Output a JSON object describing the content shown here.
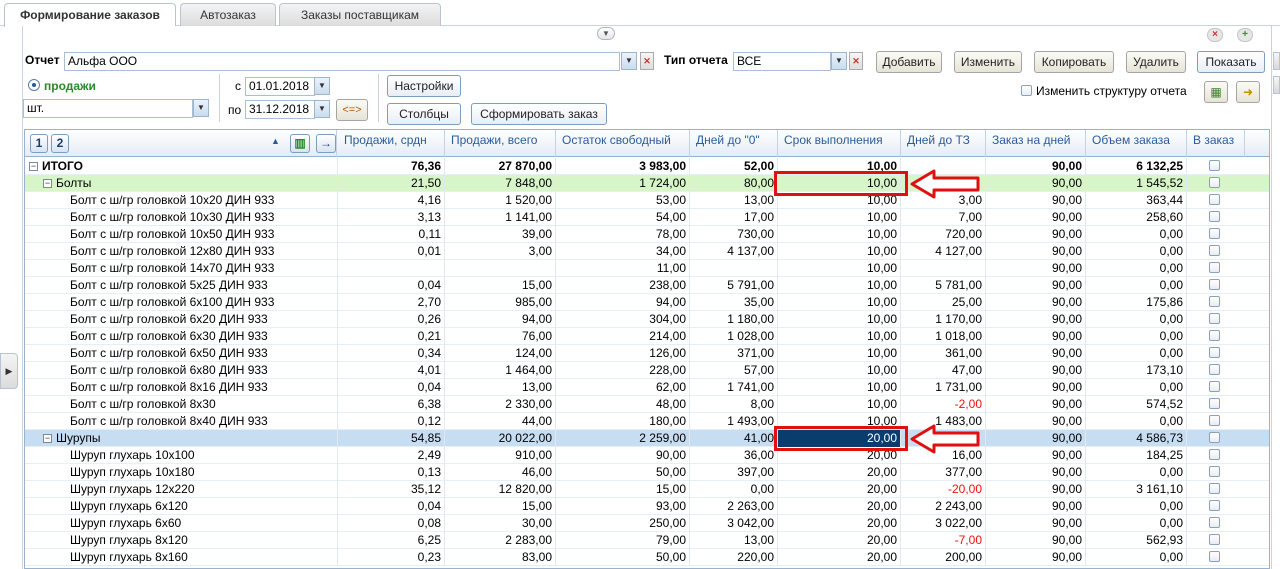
{
  "tabs": [
    "Формирование заказов",
    "Автозаказ",
    "Заказы поставщикам"
  ],
  "filters": {
    "report_label": "Отчет",
    "report_value": "Альфа ООО",
    "report_type_label": "Тип отчета",
    "report_type_value": "ВСЕ",
    "mode_label": "продажи",
    "unit_value": "шт.",
    "from_label": "с",
    "from_value": "01.01.2018",
    "to_label": "по",
    "to_value": "31.12.2018",
    "swap_label": "<=>"
  },
  "buttons": {
    "add": "Добавить",
    "edit": "Изменить",
    "copy": "Копировать",
    "delete": "Удалить",
    "show": "Показать",
    "settings": "Настройки",
    "columns": "Столбцы",
    "make_order": "Сформировать заказ"
  },
  "change_structure_label": "Изменить структуру отчета",
  "grid": {
    "pages": [
      "1",
      "2"
    ],
    "columns": [
      "Продажи, срдн",
      "Продажи, всего",
      "Остаток свободный",
      "Дней до \"0\"",
      "Срок выполнения",
      "Дней до ТЗ",
      "Заказ на дней",
      "Объем заказа",
      "В заказ"
    ],
    "rows": [
      {
        "name": "ИТОГО",
        "level": 0,
        "vals": [
          "76,36",
          "27 870,00",
          "3 983,00",
          "52,00",
          "10,00",
          "",
          "90,00",
          "6 132,25"
        ]
      },
      {
        "name": "Болты",
        "level": 1,
        "vals": [
          "21,50",
          "7 848,00",
          "1 724,00",
          "80,00",
          "10,00",
          "",
          "90,00",
          "1 545,52"
        ]
      },
      {
        "name": "Болт с ш/гр головкой 10х20 ДИН 933",
        "level": 2,
        "vals": [
          "4,16",
          "1 520,00",
          "53,00",
          "13,00",
          "10,00",
          "3,00",
          "90,00",
          "363,44"
        ]
      },
      {
        "name": "Болт с ш/гр головкой 10х30 ДИН 933",
        "level": 2,
        "vals": [
          "3,13",
          "1 141,00",
          "54,00",
          "17,00",
          "10,00",
          "7,00",
          "90,00",
          "258,60"
        ]
      },
      {
        "name": "Болт с ш/гр головкой 10х50 ДИН 933",
        "level": 2,
        "vals": [
          "0,11",
          "39,00",
          "78,00",
          "730,00",
          "10,00",
          "720,00",
          "90,00",
          "0,00"
        ]
      },
      {
        "name": "Болт с ш/гр головкой 12х80 ДИН 933",
        "level": 2,
        "vals": [
          "0,01",
          "3,00",
          "34,00",
          "4 137,00",
          "10,00",
          "4 127,00",
          "90,00",
          "0,00"
        ]
      },
      {
        "name": "Болт с ш/гр головкой 14х70 ДИН 933",
        "level": 2,
        "vals": [
          "",
          "",
          "11,00",
          "",
          "10,00",
          "",
          "90,00",
          "0,00"
        ]
      },
      {
        "name": "Болт с ш/гр головкой 5х25 ДИН 933",
        "level": 2,
        "vals": [
          "0,04",
          "15,00",
          "238,00",
          "5 791,00",
          "10,00",
          "5 781,00",
          "90,00",
          "0,00"
        ]
      },
      {
        "name": "Болт с ш/гр головкой 6х100 ДИН 933",
        "level": 2,
        "vals": [
          "2,70",
          "985,00",
          "94,00",
          "35,00",
          "10,00",
          "25,00",
          "90,00",
          "175,86"
        ]
      },
      {
        "name": "Болт с ш/гр головкой 6х20 ДИН 933",
        "level": 2,
        "vals": [
          "0,26",
          "94,00",
          "304,00",
          "1 180,00",
          "10,00",
          "1 170,00",
          "90,00",
          "0,00"
        ]
      },
      {
        "name": "Болт с ш/гр головкой 6х30 ДИН 933",
        "level": 2,
        "vals": [
          "0,21",
          "76,00",
          "214,00",
          "1 028,00",
          "10,00",
          "1 018,00",
          "90,00",
          "0,00"
        ]
      },
      {
        "name": "Болт с ш/гр головкой 6х50 ДИН 933",
        "level": 2,
        "vals": [
          "0,34",
          "124,00",
          "126,00",
          "371,00",
          "10,00",
          "361,00",
          "90,00",
          "0,00"
        ]
      },
      {
        "name": "Болт с ш/гр головкой 6х80 ДИН 933",
        "level": 2,
        "vals": [
          "4,01",
          "1 464,00",
          "228,00",
          "57,00",
          "10,00",
          "47,00",
          "90,00",
          "173,10"
        ]
      },
      {
        "name": "Болт с ш/гр головкой 8х16 ДИН 933",
        "level": 2,
        "vals": [
          "0,04",
          "13,00",
          "62,00",
          "1 741,00",
          "10,00",
          "1 731,00",
          "90,00",
          "0,00"
        ]
      },
      {
        "name": "Болт с ш/гр головкой 8х30",
        "level": 2,
        "vals": [
          "6,38",
          "2 330,00",
          "48,00",
          "8,00",
          "10,00",
          "-2,00",
          "90,00",
          "574,52"
        ]
      },
      {
        "name": "Болт с ш/гр головкой 8х40 ДИН 933",
        "level": 2,
        "vals": [
          "0,12",
          "44,00",
          "180,00",
          "1 493,00",
          "10,00",
          "1 483,00",
          "90,00",
          "0,00"
        ]
      },
      {
        "name": "Шурупы",
        "level": 1,
        "vals": [
          "54,85",
          "20 022,00",
          "2 259,00",
          "41,00",
          "20,00",
          "",
          "90,00",
          "4 586,73"
        ]
      },
      {
        "name": "Шуруп глухарь 10х100",
        "level": 2,
        "vals": [
          "2,49",
          "910,00",
          "90,00",
          "36,00",
          "20,00",
          "16,00",
          "90,00",
          "184,25"
        ]
      },
      {
        "name": "Шуруп глухарь 10х180",
        "level": 2,
        "vals": [
          "0,13",
          "46,00",
          "50,00",
          "397,00",
          "20,00",
          "377,00",
          "90,00",
          "0,00"
        ]
      },
      {
        "name": "Шуруп глухарь 12х220",
        "level": 2,
        "vals": [
          "35,12",
          "12 820,00",
          "15,00",
          "0,00",
          "20,00",
          "-20,00",
          "90,00",
          "3 161,10"
        ]
      },
      {
        "name": "Шуруп глухарь 6х120",
        "level": 2,
        "vals": [
          "0,04",
          "15,00",
          "93,00",
          "2 263,00",
          "20,00",
          "2 243,00",
          "90,00",
          "0,00"
        ]
      },
      {
        "name": "Шуруп глухарь 6х60",
        "level": 2,
        "vals": [
          "0,08",
          "30,00",
          "250,00",
          "3 042,00",
          "20,00",
          "3 022,00",
          "90,00",
          "0,00"
        ]
      },
      {
        "name": "Шуруп глухарь 8х120",
        "level": 2,
        "vals": [
          "6,25",
          "2 283,00",
          "79,00",
          "13,00",
          "20,00",
          "-7,00",
          "90,00",
          "562,93"
        ]
      },
      {
        "name": "Шуруп глухарь 8х160",
        "level": 2,
        "vals": [
          "0,23",
          "83,00",
          "50,00",
          "220,00",
          "20,00",
          "200,00",
          "90,00",
          "0,00"
        ]
      }
    ]
  }
}
